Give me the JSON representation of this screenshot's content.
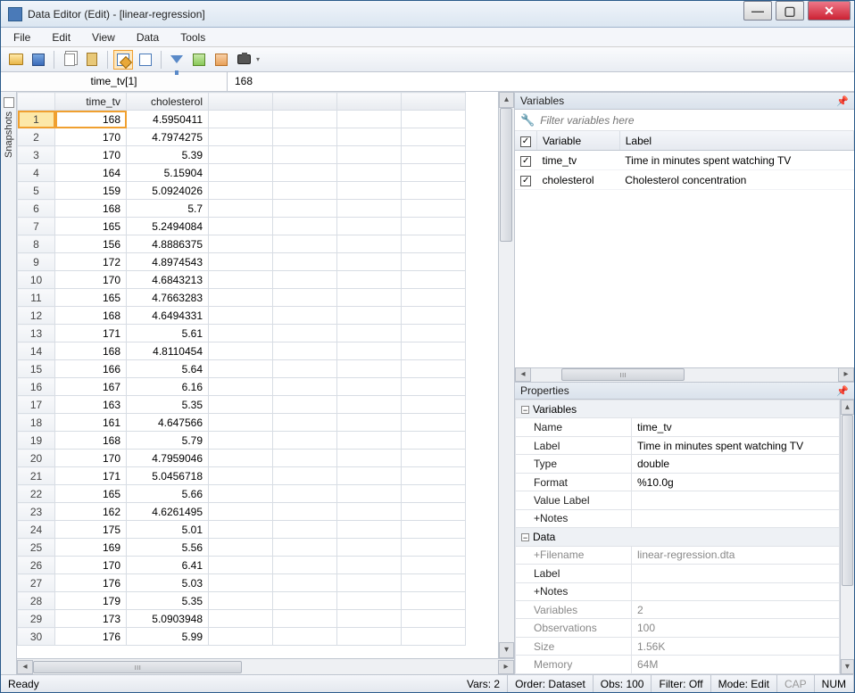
{
  "window": {
    "title": "Data Editor (Edit) - [linear-regression]"
  },
  "menu": [
    "File",
    "Edit",
    "View",
    "Data",
    "Tools"
  ],
  "refbar": {
    "name": "time_tv[1]",
    "value": "168"
  },
  "columns": [
    "time_tv",
    "cholesterol"
  ],
  "rows": [
    {
      "n": 1,
      "tv": "168",
      "ch": "4.5950411"
    },
    {
      "n": 2,
      "tv": "170",
      "ch": "4.7974275"
    },
    {
      "n": 3,
      "tv": "170",
      "ch": "5.39"
    },
    {
      "n": 4,
      "tv": "164",
      "ch": "5.15904"
    },
    {
      "n": 5,
      "tv": "159",
      "ch": "5.0924026"
    },
    {
      "n": 6,
      "tv": "168",
      "ch": "5.7"
    },
    {
      "n": 7,
      "tv": "165",
      "ch": "5.2494084"
    },
    {
      "n": 8,
      "tv": "156",
      "ch": "4.8886375"
    },
    {
      "n": 9,
      "tv": "172",
      "ch": "4.8974543"
    },
    {
      "n": 10,
      "tv": "170",
      "ch": "4.6843213"
    },
    {
      "n": 11,
      "tv": "165",
      "ch": "4.7663283"
    },
    {
      "n": 12,
      "tv": "168",
      "ch": "4.6494331"
    },
    {
      "n": 13,
      "tv": "171",
      "ch": "5.61"
    },
    {
      "n": 14,
      "tv": "168",
      "ch": "4.8110454"
    },
    {
      "n": 15,
      "tv": "166",
      "ch": "5.64"
    },
    {
      "n": 16,
      "tv": "167",
      "ch": "6.16"
    },
    {
      "n": 17,
      "tv": "163",
      "ch": "5.35"
    },
    {
      "n": 18,
      "tv": "161",
      "ch": "4.647566"
    },
    {
      "n": 19,
      "tv": "168",
      "ch": "5.79"
    },
    {
      "n": 20,
      "tv": "170",
      "ch": "4.7959046"
    },
    {
      "n": 21,
      "tv": "171",
      "ch": "5.0456718"
    },
    {
      "n": 22,
      "tv": "165",
      "ch": "5.66"
    },
    {
      "n": 23,
      "tv": "162",
      "ch": "4.6261495"
    },
    {
      "n": 24,
      "tv": "175",
      "ch": "5.01"
    },
    {
      "n": 25,
      "tv": "169",
      "ch": "5.56"
    },
    {
      "n": 26,
      "tv": "170",
      "ch": "6.41"
    },
    {
      "n": 27,
      "tv": "176",
      "ch": "5.03"
    },
    {
      "n": 28,
      "tv": "179",
      "ch": "5.35"
    },
    {
      "n": 29,
      "tv": "173",
      "ch": "5.0903948"
    },
    {
      "n": 30,
      "tv": "176",
      "ch": "5.99"
    }
  ],
  "snapshots_label": "Snapshots",
  "variables_panel": {
    "title": "Variables",
    "filter_placeholder": "Filter variables here",
    "headers": {
      "var": "Variable",
      "lbl": "Label"
    },
    "items": [
      {
        "name": "time_tv",
        "label": "Time in minutes spent watching TV"
      },
      {
        "name": "cholesterol",
        "label": "Cholesterol concentration"
      }
    ]
  },
  "properties_panel": {
    "title": "Properties",
    "groups": {
      "variables": {
        "title": "Variables",
        "name_k": "Name",
        "name_v": "time_tv",
        "label_k": "Label",
        "label_v": "Time in minutes spent watching TV",
        "type_k": "Type",
        "type_v": "double",
        "format_k": "Format",
        "format_v": "%10.0g",
        "vlabel_k": "Value Label",
        "vlabel_v": "",
        "notes_k": "Notes",
        "notes_v": ""
      },
      "data": {
        "title": "Data",
        "filename_k": "Filename",
        "filename_v": "linear-regression.dta",
        "label_k": "Label",
        "label_v": "",
        "notes_k": "Notes",
        "notes_v": "",
        "vars_k": "Variables",
        "vars_v": "2",
        "obs_k": "Observations",
        "obs_v": "100",
        "size_k": "Size",
        "size_v": "1.56K",
        "mem_k": "Memory",
        "mem_v": "64M"
      }
    }
  },
  "statusbar": {
    "ready": "Ready",
    "vars": "Vars: 2",
    "order": "Order: Dataset",
    "obs": "Obs: 100",
    "filter": "Filter: Off",
    "mode": "Mode: Edit",
    "cap": "CAP",
    "num": "NUM"
  }
}
